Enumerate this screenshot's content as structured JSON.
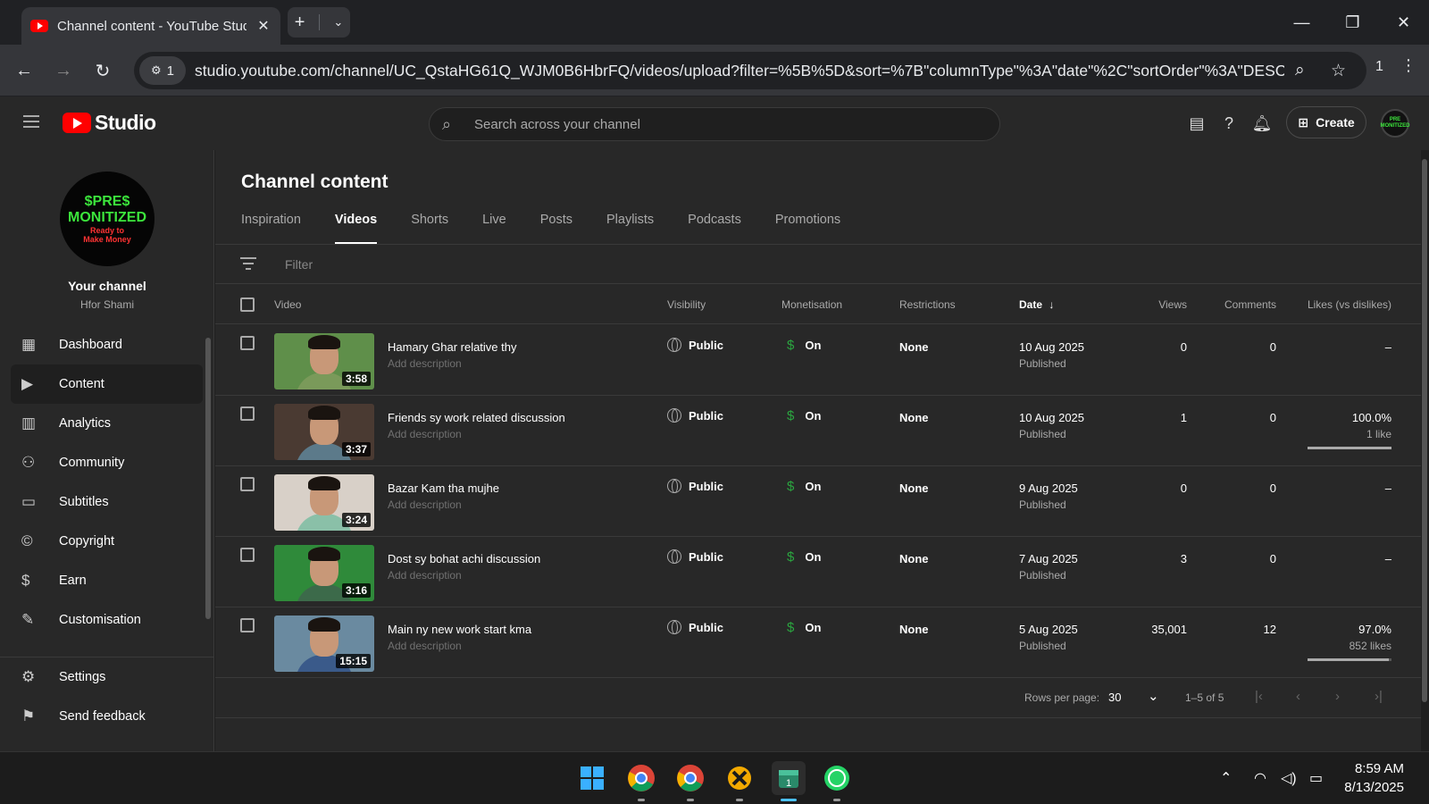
{
  "browser": {
    "tab_title": "Channel content - YouTube Studio",
    "url": "studio.youtube.com/channel/UC_QstaHG61Q_WJM0B6HbrFQ/videos/upload?filter=%5B%5D&sort=%7B\"columnType\"%3A\"date\"%2C\"sortOrder\"%3A\"DESC...",
    "site_pill_count": "1",
    "profile_count": "1"
  },
  "header": {
    "brand": "Studio",
    "search_placeholder": "Search across your channel",
    "create_label": "Create",
    "avatar_text": "PRE MONITIZED"
  },
  "sidebar": {
    "avatar_line1": "$PRE$",
    "avatar_line2": "MONITIZED",
    "avatar_line3": "Ready to",
    "avatar_line4": "Make Money",
    "channel_label": "Your channel",
    "channel_handle": "Hfor Shami",
    "items": [
      {
        "label": "Dashboard",
        "icon": "dashboard-icon"
      },
      {
        "label": "Content",
        "icon": "content-icon"
      },
      {
        "label": "Analytics",
        "icon": "analytics-icon"
      },
      {
        "label": "Community",
        "icon": "community-icon"
      },
      {
        "label": "Subtitles",
        "icon": "subtitles-icon"
      },
      {
        "label": "Copyright",
        "icon": "copyright-icon"
      },
      {
        "label": "Earn",
        "icon": "earn-icon"
      },
      {
        "label": "Customisation",
        "icon": "customisation-icon"
      }
    ],
    "settings_label": "Settings",
    "feedback_label": "Send feedback"
  },
  "main": {
    "title": "Channel content",
    "tabs": [
      "Inspiration",
      "Videos",
      "Shorts",
      "Live",
      "Posts",
      "Playlists",
      "Podcasts",
      "Promotions"
    ],
    "active_tab": "Videos",
    "filter_placeholder": "Filter",
    "columns": {
      "video": "Video",
      "visibility": "Visibility",
      "monetisation": "Monetisation",
      "restrictions": "Restrictions",
      "date": "Date",
      "views": "Views",
      "comments": "Comments",
      "likes": "Likes (vs dislikes)"
    },
    "rows": [
      {
        "title": "Hamary Ghar relative thy",
        "desc": "Add description",
        "duration": "3:58",
        "visibility": "Public",
        "monetisation": "On",
        "restrictions": "None",
        "date": "10 Aug 2025",
        "status": "Published",
        "views": "0",
        "comments": "0",
        "likes": "–",
        "likes_sub": "",
        "like_ratio": null,
        "bg": "#5f8f4a",
        "shirt": "#7a9a5a"
      },
      {
        "title": "Friends sy work related discussion",
        "desc": "Add description",
        "duration": "3:37",
        "visibility": "Public",
        "monetisation": "On",
        "restrictions": "None",
        "date": "10 Aug 2025",
        "status": "Published",
        "views": "1",
        "comments": "0",
        "likes": "100.0%",
        "likes_sub": "1 like",
        "like_ratio": 1.0,
        "bg": "#4a3a32",
        "shirt": "#5c7a8a"
      },
      {
        "title": "Bazar Kam tha mujhe",
        "desc": "Add description",
        "duration": "3:24",
        "visibility": "Public",
        "monetisation": "On",
        "restrictions": "None",
        "date": "9 Aug 2025",
        "status": "Published",
        "views": "0",
        "comments": "0",
        "likes": "–",
        "likes_sub": "",
        "like_ratio": null,
        "bg": "#d8d0c8",
        "shirt": "#8ac0a8"
      },
      {
        "title": "Dost sy bohat achi discussion",
        "desc": "Add description",
        "duration": "3:16",
        "visibility": "Public",
        "monetisation": "On",
        "restrictions": "None",
        "date": "7 Aug 2025",
        "status": "Published",
        "views": "3",
        "comments": "0",
        "likes": "–",
        "likes_sub": "",
        "like_ratio": null,
        "bg": "#2f8a3a",
        "shirt": "#3c6a4a"
      },
      {
        "title": "Main ny new work start kma",
        "desc": "Add description",
        "duration": "15:15",
        "visibility": "Public",
        "monetisation": "On",
        "restrictions": "None",
        "date": "5 Aug 2025",
        "status": "Published",
        "views": "35,001",
        "comments": "12",
        "likes": "97.0%",
        "likes_sub": "852 likes",
        "like_ratio": 0.97,
        "bg": "#6a8aa0",
        "shirt": "#3a5a8a"
      }
    ],
    "pager": {
      "rows_per_page_label": "Rows per page:",
      "rows_per_page": "30",
      "range": "1–5 of 5"
    }
  },
  "taskbar": {
    "time": "8:59 AM",
    "date": "8/13/2025"
  }
}
